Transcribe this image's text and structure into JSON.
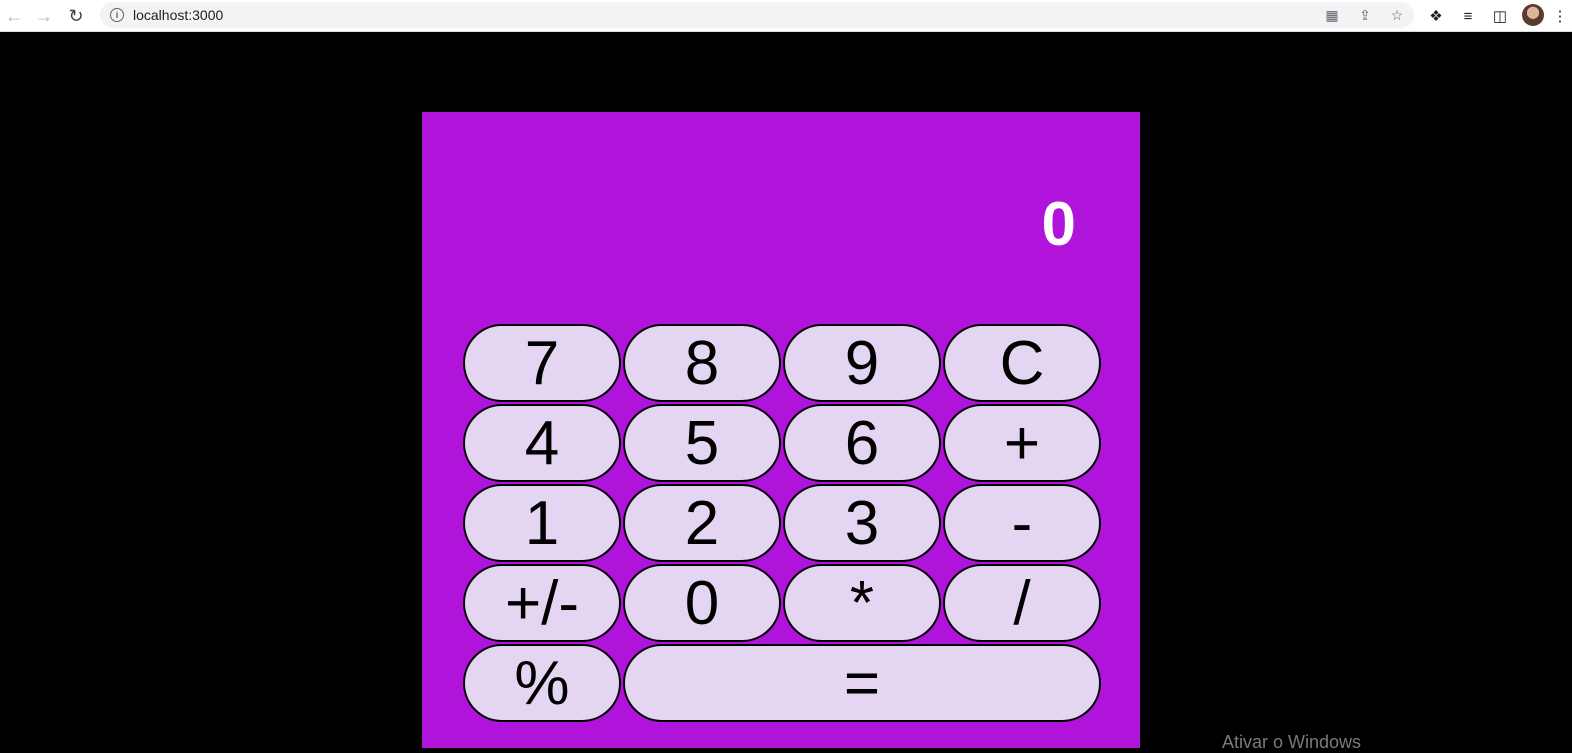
{
  "browser": {
    "url": "localhost:3000",
    "icons": {
      "back": "arrow-left-icon",
      "forward": "arrow-right-icon",
      "reload": "reload-icon",
      "info": "info-icon",
      "translate": "translate-icon",
      "share": "share-icon",
      "bookmark": "star-icon",
      "extensions": "puzzle-icon",
      "reading_list": "reading-list-icon",
      "side_panel": "side-panel-icon",
      "profile": "avatar",
      "menu": "kebab-menu-icon"
    }
  },
  "calculator": {
    "display_value": "0",
    "keys": [
      {
        "label": "7",
        "name": "key-7"
      },
      {
        "label": "8",
        "name": "key-8"
      },
      {
        "label": "9",
        "name": "key-9"
      },
      {
        "label": "C",
        "name": "clear-button"
      },
      {
        "label": "4",
        "name": "key-4"
      },
      {
        "label": "5",
        "name": "key-5"
      },
      {
        "label": "6",
        "name": "key-6"
      },
      {
        "label": "+",
        "name": "plus-button"
      },
      {
        "label": "1",
        "name": "key-1"
      },
      {
        "label": "2",
        "name": "key-2"
      },
      {
        "label": "3",
        "name": "key-3"
      },
      {
        "label": "-",
        "name": "minus-button"
      },
      {
        "label": "+/-",
        "name": "sign-toggle-button"
      },
      {
        "label": "0",
        "name": "key-0"
      },
      {
        "label": "*",
        "name": "multiply-button"
      },
      {
        "label": "/",
        "name": "divide-button"
      },
      {
        "label": "%",
        "name": "percent-button"
      },
      {
        "label": "=",
        "name": "equals-button"
      }
    ]
  },
  "colors": {
    "page_background": "#000000",
    "calculator_background": "#b013d9",
    "key_background": "#e4d5f3",
    "display_text": "#ffffff"
  },
  "watermark": "Ativar o Windows"
}
